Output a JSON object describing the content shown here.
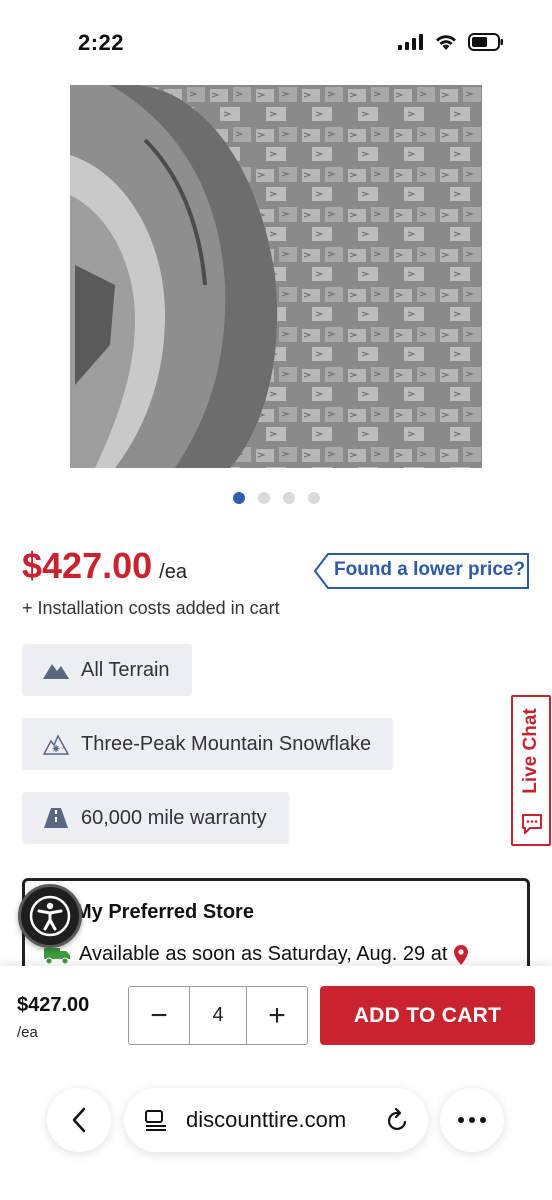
{
  "status_bar": {
    "time": "2:22"
  },
  "carousel": {
    "count": 4,
    "active_index": 0
  },
  "product": {
    "price": "$427.00",
    "price_unit": "/ea",
    "install_note": "+ Installation costs added in cart",
    "lower_price_label": "Found a lower price?"
  },
  "features": [
    {
      "label": "All Terrain",
      "icon": "mountain-icon"
    },
    {
      "label": "Three-Peak Mountain Snowflake",
      "icon": "snowflake-mountain-icon"
    },
    {
      "label": "60,000 mile warranty",
      "icon": "road-icon"
    }
  ],
  "live_chat": {
    "label": "Live Chat"
  },
  "store": {
    "title": "My Preferred Store",
    "availability": "Available as soon as Saturday, Aug. 29 at"
  },
  "bottom_bar": {
    "price": "$427.00",
    "unit": "/ea",
    "quantity": "4",
    "decrement": "−",
    "increment": "+",
    "add_to_cart": "ADD TO CART"
  },
  "browser": {
    "url": "discounttire.com"
  },
  "colors": {
    "brand_red": "#c8232f",
    "link_blue": "#2c5aa8",
    "tag_bg": "#eceef1"
  }
}
